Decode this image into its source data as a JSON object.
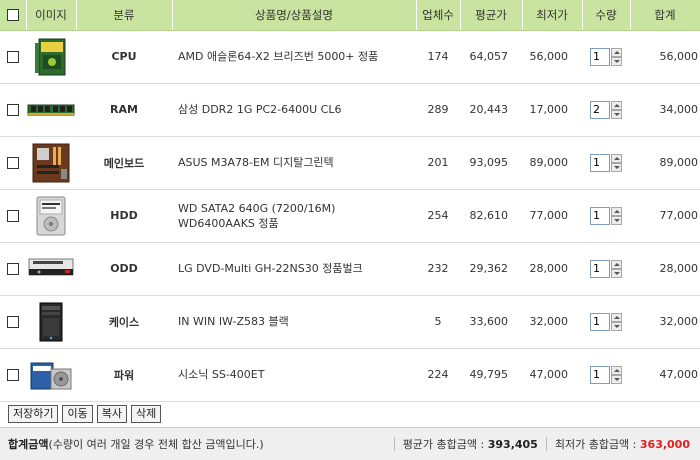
{
  "table": {
    "headers": {
      "image": "이미지",
      "category": "분류",
      "name": "상품명/상품설명",
      "sellers": "업체수",
      "avg": "평균가",
      "min": "최저가",
      "qty": "수량",
      "sum": "합계"
    },
    "rows": [
      {
        "category": "CPU",
        "name": "AMD 애슬론64-X2 브리즈번 5000+ 정품",
        "sellers": "174",
        "avg": "64,057",
        "min": "56,000",
        "qty": "1",
        "sum": "56,000",
        "image_icon": "cpu-box-icon"
      },
      {
        "category": "RAM",
        "name": "삼성 DDR2 1G PC2-6400U CL6",
        "sellers": "289",
        "avg": "20,443",
        "min": "17,000",
        "qty": "2",
        "sum": "34,000",
        "image_icon": "ram-stick-icon"
      },
      {
        "category": "메인보드",
        "name": "ASUS M3A78-EM 디지탈그린텍",
        "sellers": "201",
        "avg": "93,095",
        "min": "89,000",
        "qty": "1",
        "sum": "89,000",
        "image_icon": "motherboard-icon"
      },
      {
        "category": "HDD",
        "name": "WD SATA2 640G (7200/16M) WD6400AAKS 정품",
        "sellers": "254",
        "avg": "82,610",
        "min": "77,000",
        "qty": "1",
        "sum": "77,000",
        "image_icon": "hard-drive-icon"
      },
      {
        "category": "ODD",
        "name": "LG DVD-Multi GH-22NS30 정품벌크",
        "sellers": "232",
        "avg": "29,362",
        "min": "28,000",
        "qty": "1",
        "sum": "28,000",
        "image_icon": "optical-drive-icon"
      },
      {
        "category": "케이스",
        "name": "IN WIN IW-Z583 블랙",
        "sellers": "5",
        "avg": "33,600",
        "min": "32,000",
        "qty": "1",
        "sum": "32,000",
        "image_icon": "pc-case-icon"
      },
      {
        "category": "파워",
        "name": "시소닉 SS-400ET",
        "sellers": "224",
        "avg": "49,795",
        "min": "47,000",
        "qty": "1",
        "sum": "47,000",
        "image_icon": "power-supply-icon"
      }
    ]
  },
  "actions": {
    "save": "저장하기",
    "move": "이동",
    "copy": "복사",
    "delete": "삭제"
  },
  "totals": {
    "label": "합계금액",
    "note": "(수량이 여러 개일 경우 전체 합산 금액입니다.)",
    "avg_label": "평균가 총합금액 :",
    "avg_value": "393,405",
    "min_label": "최저가 총합금액 :",
    "min_value": "363,000"
  },
  "colors": {
    "header_bg": "#c8e4a0",
    "min_price": "#f08000",
    "total_min": "#e02020"
  }
}
